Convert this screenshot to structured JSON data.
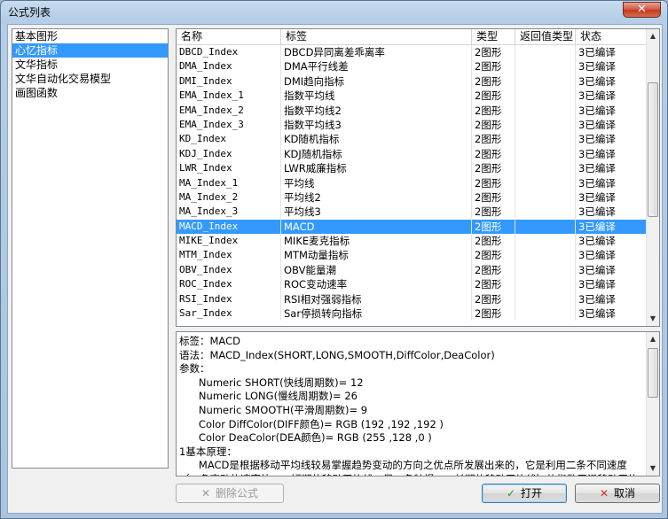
{
  "window": {
    "title": "公式列表",
    "close_glyph": "✕"
  },
  "categories": [
    {
      "label": "基本图形",
      "selected": false
    },
    {
      "label": "心忆指标",
      "selected": true
    },
    {
      "label": "文华指标",
      "selected": false
    },
    {
      "label": "文华自动化交易模型",
      "selected": false
    },
    {
      "label": "画图函数",
      "selected": false
    }
  ],
  "table": {
    "headers": [
      "名称",
      "标签",
      "类型",
      "返回值类型",
      "状态"
    ],
    "rows": [
      {
        "name": "DBCD_Index",
        "label": "DBCD异同离差乖离率",
        "type": "2图形",
        "ret": "",
        "status": "3已编译",
        "selected": false
      },
      {
        "name": "DMA_Index",
        "label": "DMA平行线差",
        "type": "2图形",
        "ret": "",
        "status": "3已编译",
        "selected": false
      },
      {
        "name": "DMI_Index",
        "label": "DMI趋向指标",
        "type": "2图形",
        "ret": "",
        "status": "3已编译",
        "selected": false
      },
      {
        "name": "EMA_Index_1",
        "label": "指数平均线",
        "type": "2图形",
        "ret": "",
        "status": "3已编译",
        "selected": false
      },
      {
        "name": "EMA_Index_2",
        "label": "指数平均线2",
        "type": "2图形",
        "ret": "",
        "status": "3已编译",
        "selected": false
      },
      {
        "name": "EMA_Index_3",
        "label": "指数平均线3",
        "type": "2图形",
        "ret": "",
        "status": "3已编译",
        "selected": false
      },
      {
        "name": "KD_Index",
        "label": "KD随机指标",
        "type": "2图形",
        "ret": "",
        "status": "3已编译",
        "selected": false
      },
      {
        "name": "KDJ_Index",
        "label": "KDJ随机指标",
        "type": "2图形",
        "ret": "",
        "status": "3已编译",
        "selected": false
      },
      {
        "name": "LWR_Index",
        "label": "LWR威廉指标",
        "type": "2图形",
        "ret": "",
        "status": "3已编译",
        "selected": false
      },
      {
        "name": "MA_Index_1",
        "label": "平均线",
        "type": "2图形",
        "ret": "",
        "status": "3已编译",
        "selected": false
      },
      {
        "name": "MA_Index_2",
        "label": "平均线2",
        "type": "2图形",
        "ret": "",
        "status": "3已编译",
        "selected": false
      },
      {
        "name": "MA_Index_3",
        "label": "平均线3",
        "type": "2图形",
        "ret": "",
        "status": "3已编译",
        "selected": false
      },
      {
        "name": "MACD_Index",
        "label": "MACD",
        "type": "2图形",
        "ret": "",
        "status": "3已编译",
        "selected": true
      },
      {
        "name": "MIKE_Index",
        "label": "MIKE麦克指标",
        "type": "2图形",
        "ret": "",
        "status": "3已编译",
        "selected": false
      },
      {
        "name": "MTM_Index",
        "label": "MTM动量指标",
        "type": "2图形",
        "ret": "",
        "status": "3已编译",
        "selected": false
      },
      {
        "name": "OBV_Index",
        "label": "OBV能量潮",
        "type": "2图形",
        "ret": "",
        "status": "3已编译",
        "selected": false
      },
      {
        "name": "ROC_Index",
        "label": "ROC变动速率",
        "type": "2图形",
        "ret": "",
        "status": "3已编译",
        "selected": false
      },
      {
        "name": "RSI_Index",
        "label": "RSI相对强弱指标",
        "type": "2图形",
        "ret": "",
        "status": "3已编译",
        "selected": false
      },
      {
        "name": "Sar_Index",
        "label": "Sar停损转向指标",
        "type": "2图形",
        "ret": "",
        "status": "3已编译",
        "selected": false
      }
    ]
  },
  "description": {
    "lines": [
      "标签：MACD",
      "语法：MACD_Index(SHORT,LONG,SMOOTH,DiffColor,DeaColor)",
      "参数：",
      "      Numeric SHORT(快线周期数)= 12",
      "      Numeric LONG(慢线周期数)= 26",
      "      Numeric SMOOTH(平滑周期数)= 9",
      "      Color DiffColor(DIFF颜色)= RGB (192 ,192 ,192 )",
      "      Color DeaColor(DEA颜色)= RGB (255 ,128 ,0 )",
      "1基本原理：",
      "      MACD是根据移动平均线较易掌握趋势变动的方向之优点所发展出来的，它是利用二条不同速度",
      "（一条变动的速率快——短期的移动平均线，另一条较慢——长期的移动平均线）的指数平滑移动平均"
    ]
  },
  "buttons": {
    "delete": {
      "icon": "✕",
      "label": "删除公式",
      "enabled": false
    },
    "open": {
      "icon": "✓",
      "label": "打开"
    },
    "cancel": {
      "icon": "✕",
      "label": "取消"
    }
  },
  "colors": {
    "selection": "#3399ff",
    "open_check": "#2a9d2a",
    "cancel_x": "#d03020"
  }
}
